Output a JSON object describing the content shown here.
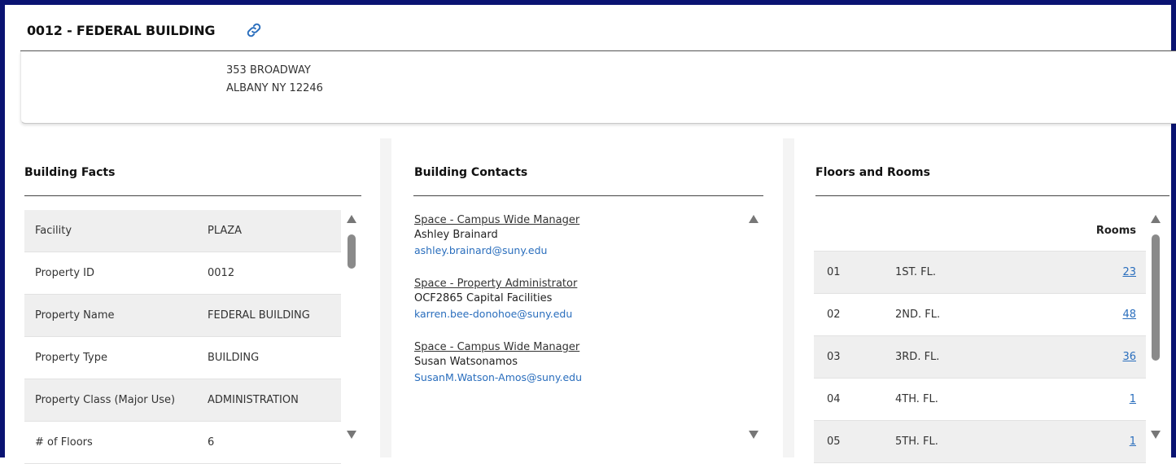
{
  "header": {
    "title": "0012 - FEDERAL BUILDING",
    "link_icon": "link-icon"
  },
  "address": {
    "line1": "353 BROADWAY",
    "line2": "ALBANY NY 12246"
  },
  "building_facts": {
    "title": "Building Facts",
    "rows": [
      {
        "label": "Facility",
        "value": "PLAZA"
      },
      {
        "label": "Property ID",
        "value": "0012"
      },
      {
        "label": "Property Name",
        "value": "FEDERAL BUILDING"
      },
      {
        "label": "Property Type",
        "value": "BUILDING"
      },
      {
        "label": "Property Class (Major Use)",
        "value": "ADMINISTRATION"
      },
      {
        "label": "# of Floors",
        "value": "6"
      }
    ]
  },
  "building_contacts": {
    "title": "Building Contacts",
    "contacts": [
      {
        "role": "Space - Campus Wide Manager",
        "name": "Ashley Brainard",
        "email": "ashley.brainard@suny.edu"
      },
      {
        "role": "Space - Property Administrator",
        "name": "OCF2865 Capital Facilities",
        "email": "karren.bee-donohoe@suny.edu"
      },
      {
        "role": "Space - Campus Wide Manager",
        "name": "Susan Watsonamos",
        "email": "SusanM.Watson-Amos@suny.edu"
      }
    ]
  },
  "floors_and_rooms": {
    "title": "Floors and Rooms",
    "rooms_header": "Rooms",
    "floors": [
      {
        "num": "01",
        "name": "1ST. FL.",
        "rooms": "23"
      },
      {
        "num": "02",
        "name": "2ND. FL.",
        "rooms": "48"
      },
      {
        "num": "03",
        "name": "3RD. FL.",
        "rooms": "36"
      },
      {
        "num": "04",
        "name": "4TH. FL.",
        "rooms": "1"
      },
      {
        "num": "05",
        "name": "5TH. FL.",
        "rooms": "1"
      }
    ]
  },
  "colors": {
    "frame": "#0a1372",
    "link": "#2a6ebd",
    "row_alt": "#efefef"
  }
}
